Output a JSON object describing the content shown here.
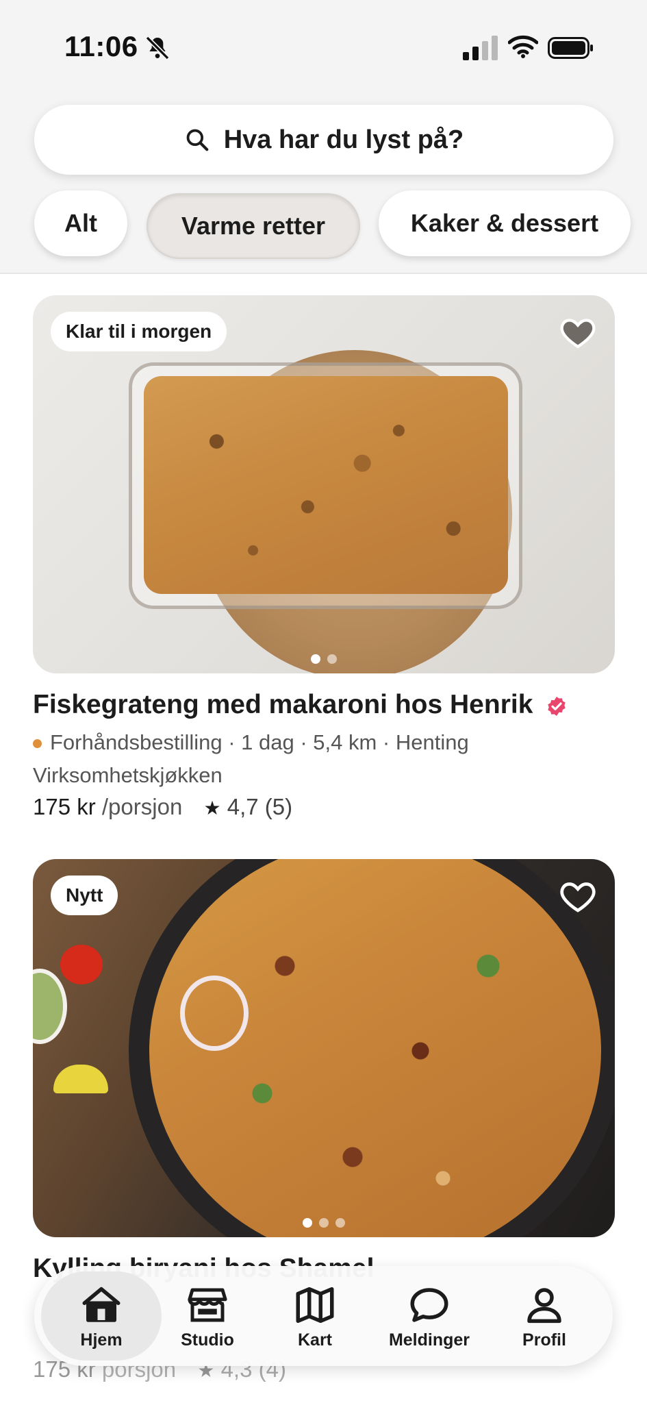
{
  "status_bar": {
    "time": "11:06",
    "icons": [
      "bell-slash-icon",
      "signal-icon",
      "wifi-icon",
      "battery-icon"
    ]
  },
  "search": {
    "placeholder": "Hva har du lyst på?",
    "icon": "search-icon"
  },
  "filters": {
    "chips": [
      {
        "label": "Alt",
        "selected": false
      },
      {
        "label": "Varme retter",
        "selected": true
      },
      {
        "label": "Kaker & dessert",
        "selected": false
      }
    ]
  },
  "listings": [
    {
      "badge": "Klar til i morgen",
      "title": "Fiskegrateng med makaroni hos Henrik",
      "verified": true,
      "status_color": "#e0903a",
      "meta_line1": "Forhåndsbestilling · 1 dag · 5,4 km · Henting",
      "meta_line2": "Virksomhetskjøkken",
      "price": "175 kr",
      "price_unit": "/porsjon",
      "rating": "4,7 (5)",
      "image_count": 2,
      "image_index": 0,
      "favorited": true
    },
    {
      "badge": "Nytt",
      "title": "Kylling biryani hos Shamel",
      "verified": true,
      "price": "175 kr",
      "price_unit": " porsjon",
      "rating": "4,3 (4)",
      "image_count": 3,
      "image_index": 0,
      "favorited": false
    }
  ],
  "bottom_nav": {
    "items": [
      {
        "label": "Hjem",
        "icon": "home-icon",
        "active": true
      },
      {
        "label": "Studio",
        "icon": "storefront-icon",
        "active": false
      },
      {
        "label": "Kart",
        "icon": "map-icon",
        "active": false
      },
      {
        "label": "Meldinger",
        "icon": "chat-bubble-icon",
        "active": false
      },
      {
        "label": "Profil",
        "icon": "person-icon",
        "active": false
      }
    ]
  },
  "colors": {
    "accent_verified": "#e8466c",
    "header_bg": "#f4f4f4"
  }
}
